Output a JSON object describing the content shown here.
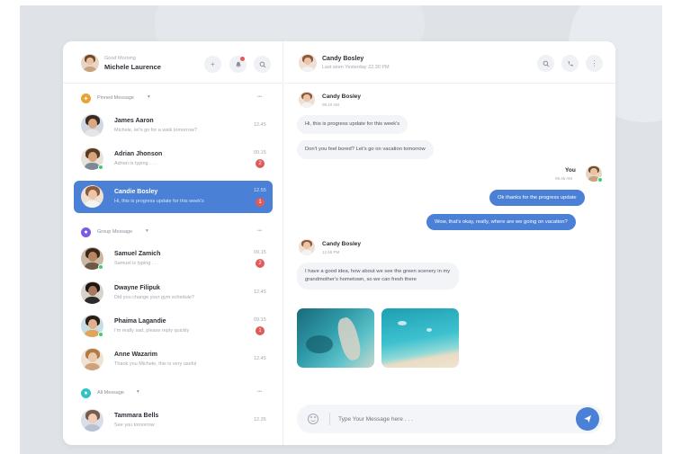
{
  "profile": {
    "greeting": "Good Morning",
    "name": "Michele Laurence"
  },
  "header_icons": [
    "plus-icon",
    "bell-icon",
    "search-icon"
  ],
  "sections": {
    "pinned": {
      "label": "Pinned Message",
      "more": "•••"
    },
    "group": {
      "label": "Group Message",
      "more": "•••"
    },
    "all": {
      "label": "All Message",
      "more": "•••"
    }
  },
  "pinned": [
    {
      "name": "James Aaron",
      "preview": "Michele, let's go for a walk tomorrow?",
      "time": "12.45"
    },
    {
      "name": "Adrian Jhonson",
      "preview": "Adrian is typing . . .",
      "time": "09.15",
      "badge": "2"
    },
    {
      "name": "Candie Bosley",
      "preview": "Hi, this is progress update for this week's",
      "time": "12.55",
      "badge": "1"
    }
  ],
  "group": [
    {
      "name": "Samuel Zamich",
      "preview": "Samuel is typing . . .",
      "time": "09.15",
      "badge": "2"
    },
    {
      "name": "Dwayne Filipuk",
      "preview": "Did you change your gym schedule?",
      "time": "12.45"
    },
    {
      "name": "Phaima Lagandie",
      "preview": "I'm really sad, please reply quickly",
      "time": "09.15",
      "badge": "1"
    },
    {
      "name": "Anne Wazarim",
      "preview": "Thank you Michele, this is very useful",
      "time": "12.45"
    }
  ],
  "all": [
    {
      "name": "Tammara Bells",
      "preview": "See you tomorrow",
      "time": "12.35"
    }
  ],
  "chat": {
    "contact_name": "Candy Bosley",
    "last_seen": "Last seen Yesterday 22.30 PM",
    "msg_block1": {
      "sender": "Candy Bosley",
      "time": "09.10 AM"
    },
    "msg1": "Hi, this is progress update for this week's",
    "msg2": "Don't you feel bored? Let's go on vacation tomorrow",
    "you_label": "You",
    "you_time": "09.45 AM",
    "out1": "Ok thanks for the progress update",
    "out2": "Wow, that's okay, really, where are we going on vacation?",
    "msg_block2": {
      "sender": "Candy Bosley",
      "time": "12.55 PM"
    },
    "msg3": "I have a good idea, how about we see the green scenery in my grandmother's hometown, so we can fresh there",
    "input_placeholder": "Type Your Message here . . ."
  },
  "colors": {
    "accent": "#4a80d6",
    "badge": "#e05a5a",
    "online": "#3ccf6e",
    "pinned": "#e8a23a",
    "group": "#7a5ce0",
    "all": "#2ec4c4"
  }
}
